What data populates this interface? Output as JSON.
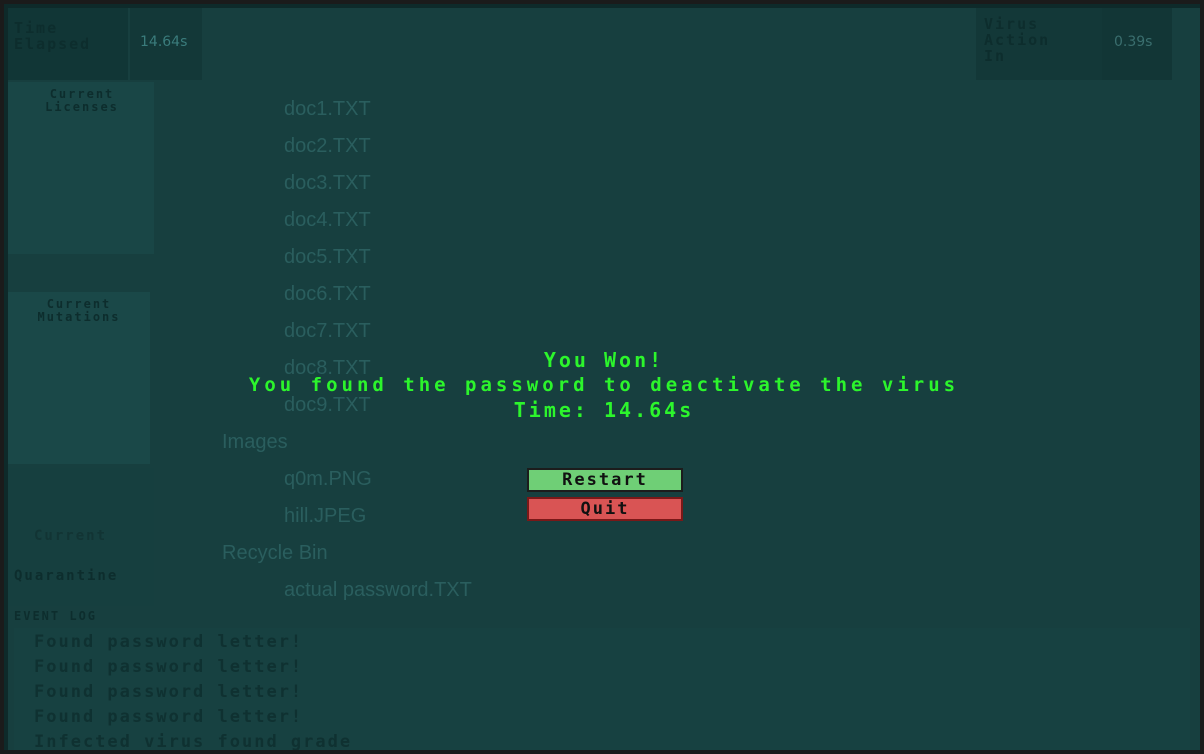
{
  "hud": {
    "time_elapsed_label": "Time\nElapsed",
    "time_elapsed_value": "14.64s",
    "virus_action_label": "Virus\nAction\nIn",
    "virus_action_value": "0.39s"
  },
  "sidebar": {
    "licenses_label": "Current\nLicenses",
    "mutations_label": "Current\nMutations",
    "quarantine_label_top": "Current",
    "quarantine_label": "Quarantine"
  },
  "file_tree": [
    "doc1.TXT",
    "doc2.TXT",
    "doc3.TXT",
    "doc4.TXT",
    "doc5.TXT",
    "doc6.TXT",
    "doc7.TXT",
    "doc8.TXT",
    "doc9.TXT",
    "Images",
    "q0m.PNG",
    "hill.JPEG",
    "Recycle Bin",
    "actual password.TXT"
  ],
  "event_log": {
    "title": "EVENT LOG",
    "lines": [
      "Found password letter!",
      "Found password letter!",
      "Found password letter!",
      "Found password letter!",
      "Infected virus found grade"
    ]
  },
  "win": {
    "title": "You Won!",
    "message": "You found the password to deactivate the virus",
    "time_line": "Time: 14.64s",
    "restart_label": "Restart",
    "quit_label": "Quit"
  }
}
